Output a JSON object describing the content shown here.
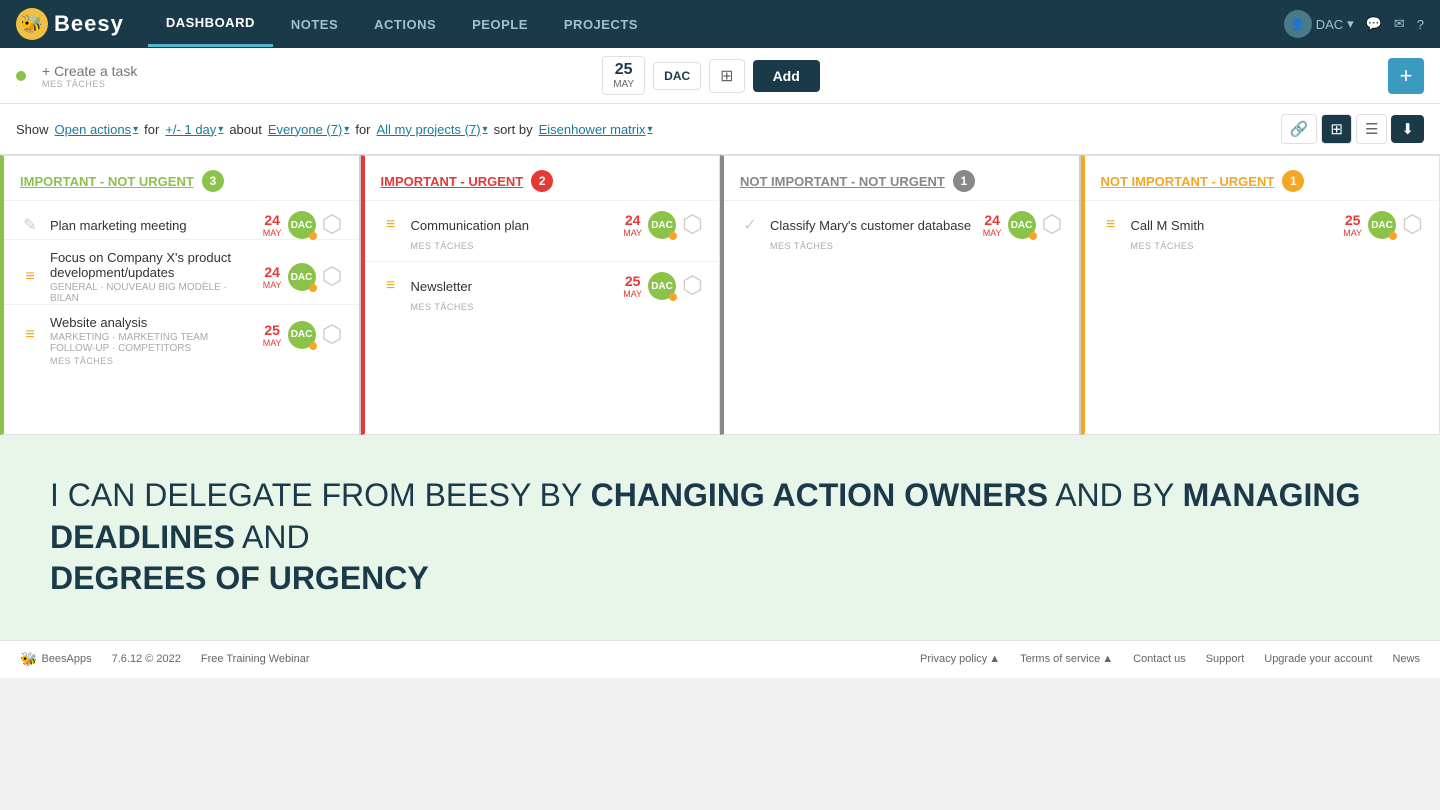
{
  "nav": {
    "logo_text": "Beesy",
    "items": [
      {
        "label": "DASHBOARD",
        "active": true
      },
      {
        "label": "NOTES",
        "active": false
      },
      {
        "label": "ACTIONS",
        "active": false
      },
      {
        "label": "PEOPLE",
        "active": false
      },
      {
        "label": "PROJECTS",
        "active": false
      }
    ],
    "right": {
      "user": "DAC",
      "chat_icon": "💬",
      "mail_icon": "✉",
      "help_icon": "?"
    }
  },
  "toolbar": {
    "create_task_placeholder": "+ Create a task",
    "mes_taches_label": "MES TÂCHES",
    "date_day": "25",
    "date_month": "MAY",
    "user_label": "DAC",
    "add_label": "Add",
    "plus_label": "+"
  },
  "filter_bar": {
    "show_label": "Show",
    "open_actions_label": "Open actions",
    "for_label": "for",
    "plusminus_day_label": "+/- 1 day",
    "about_label": "about",
    "everyone_label": "Everyone (7)",
    "for2_label": "for",
    "all_projects_label": "All my projects (7)",
    "sort_by_label": "sort by",
    "eisenhower_label": "Eisenhower matrix",
    "view_link": "🔗",
    "view_grid": "⊞",
    "view_list": "☰",
    "view_download": "⬇"
  },
  "quadrants": {
    "q1": {
      "title": "IMPORTANT - NOT URGENT",
      "badge": "3",
      "badge_class": "green",
      "title_class": "green",
      "tasks": [
        {
          "name": "Plan marketing meeting",
          "sub": "",
          "date_day": "24",
          "date_month": "MAY",
          "avatar": "DAC",
          "mes_taches": ""
        },
        {
          "name": "Focus on Company X's product development/updates",
          "sub": "GENERAL · NOUVEAU BIG MODÈLE · BILAN",
          "date_day": "24",
          "date_month": "MAY",
          "avatar": "DAC",
          "mes_taches": ""
        },
        {
          "name": "Website analysis",
          "sub": "MARKETING · MARKETING TEAM FOLLOW-UP · COMPETITORS",
          "date_day": "25",
          "date_month": "MAY",
          "avatar": "DAC",
          "mes_taches": "MES TÂCHES"
        }
      ]
    },
    "q2": {
      "title": "IMPORTANT - URGENT",
      "badge": "2",
      "badge_class": "red",
      "title_class": "red",
      "tasks": [
        {
          "name": "Communication plan",
          "sub": "",
          "date_day": "24",
          "date_month": "MAY",
          "avatar": "DAC",
          "mes_taches": "MES TÂCHES"
        },
        {
          "name": "Newsletter",
          "sub": "",
          "date_day": "25",
          "date_month": "MAY",
          "avatar": "DAC",
          "mes_taches": "MES TÂCHES"
        }
      ]
    },
    "q3": {
      "title": "NOT IMPORTANT - NOT URGENT",
      "badge": "1",
      "badge_class": "gray",
      "title_class": "gray",
      "tasks": [
        {
          "name": "Classify Mary's customer database",
          "sub": "",
          "date_day": "24",
          "date_month": "MAY",
          "avatar": "DAC",
          "mes_taches": "MES TÂCHES"
        }
      ]
    },
    "q4": {
      "title": "NOT IMPORTANT - URGENT",
      "badge": "1",
      "badge_class": "orange",
      "title_class": "orange",
      "tasks": [
        {
          "name": "Call M Smith",
          "sub": "",
          "date_day": "25",
          "date_month": "MAY",
          "avatar": "DAC",
          "mes_taches": "MES TÂCHES"
        }
      ]
    }
  },
  "promo": {
    "text_normal": "I CAN DELEGATE FROM BEESY BY ",
    "text_bold1": "CHANGING ACTION OWNERS",
    "text_normal2": " AND BY ",
    "text_bold2": "MANAGING DEADLINES",
    "text_normal3": " AND ",
    "text_bold3": "DEGREES OF URGENCY"
  },
  "footer": {
    "logo": "BeesApps",
    "bee": "🐝",
    "version": "7.6.12 © 2022",
    "training": "Free Training Webinar",
    "privacy": "Privacy policy",
    "terms": "Terms of service",
    "contact": "Contact us",
    "support": "Support",
    "upgrade": "Upgrade your account",
    "news": "News"
  }
}
